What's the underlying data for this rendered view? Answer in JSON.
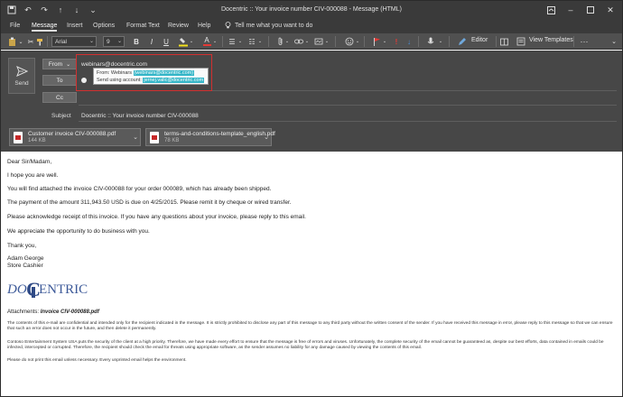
{
  "window": {
    "title": "Docentric :: Your invoice number CIV-000088  -  Message (HTML)"
  },
  "menu": {
    "tabs": [
      "File",
      "Message",
      "Insert",
      "Options",
      "Format Text",
      "Review",
      "Help"
    ],
    "tell_me": "Tell me what you want to do"
  },
  "ribbon": {
    "font_name": "Arial",
    "font_size": "9",
    "bold": "B",
    "italic": "I",
    "underline": "U",
    "font_color_letter": "A",
    "editor_label": "Editor",
    "view_templates_label": "View Templates"
  },
  "compose": {
    "send_label": "Send",
    "from_label": "From",
    "from_value": "webinars@docentric.com",
    "to_label": "To",
    "cc_label": "Cc",
    "subject_label": "Subject",
    "subject_value": "Docentric :: Your invoice number CIV-000088",
    "tooltip_line1_prefix": "From: Webinars",
    "tooltip_line1_hl": "(webinars@docentric.com)",
    "tooltip_line2_prefix": "Send using account:",
    "tooltip_line2_hl": "jernej.valic@docentric.com"
  },
  "attachments": [
    {
      "name": "Customer invoice CIV-000088.pdf",
      "size": "144 KB"
    },
    {
      "name": "terms-and-conditions-template_english.pdf",
      "size": "78 KB"
    }
  ],
  "body": {
    "greeting": "Dear Sir/Madam,",
    "line1": "I hope you are well.",
    "line2": "You will find attached the invoice CIV-000088 for your order 000089, which has already been shipped.",
    "line3": "The payment of the amount 311,943.50 USD is due on 4/25/2015. Please remit it by cheque or wired transfer.",
    "line4": "Please acknowledge receipt of this invoice. If you have any questions about your invoice, please reply to this email.",
    "line5": "We appreciate the opportunity to do business with you.",
    "thanks": "Thank you,",
    "signer_name": "Adam George",
    "signer_title": "Store Cashier",
    "logo_text_left": "DO",
    "logo_text_c": "C",
    "logo_text_right": "ENTRIC",
    "attachments_label": "Attachments:",
    "attachments_value": "Invoice CIV-000088.pdf",
    "disclaimer1": "The contents of this e-mail are confidential and intended only for the recipient indicated in the message. It is strictly prohibited to disclose any part of this message to any third party without the written consent of the sender. If you have received this message in error, please reply to this message so that we can ensure that such an error does not occur in the future, and then delete it permanently.",
    "disclaimer2": "Contoso Entertainment System USA puts the security of the client at a high priority. Therefore, we have made every effort to ensure that the message is free of errors and viruses. Unfortunately, the complete security of the email cannot be guaranteed as, despite our best efforts, data contained in emails could be infected, intercepted or corrupted. Therefore, the recipient should check the email for threats using appropriate software, as the sender assumes no liability for any damage caused by viewing the contents of this email.",
    "disclaimer3": "Please do not print this email unless necessary. Every unprinted email helps the environment."
  },
  "colors": {
    "titlebar": "#3a3a3a",
    "ribbon": "#505050",
    "header": "#474747",
    "highlight": "#33b5c7",
    "red_outline": "#d23030",
    "logo_blue": "#3d5a99"
  }
}
